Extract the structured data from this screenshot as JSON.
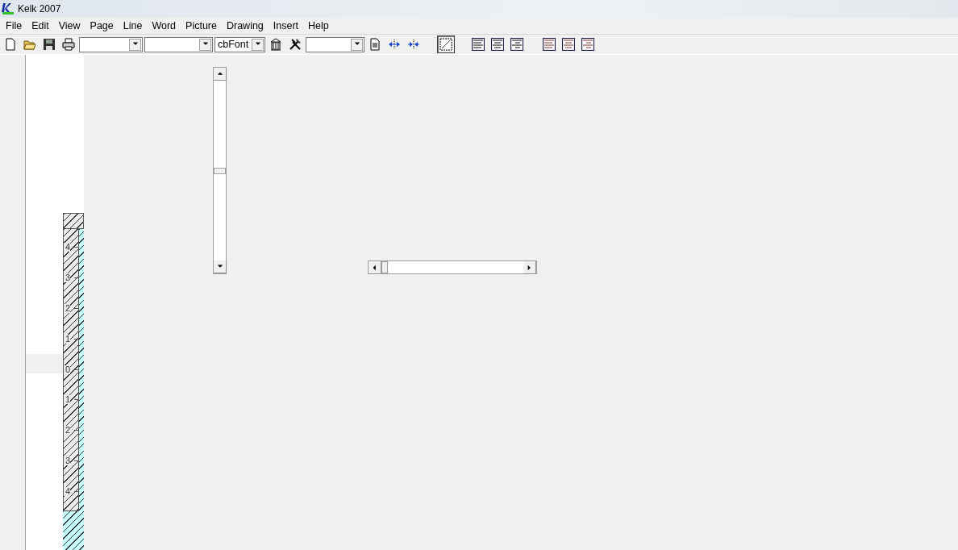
{
  "window": {
    "title": "Kelk 2007"
  },
  "menu": [
    "File",
    "Edit",
    "View",
    "Page",
    "Line",
    "Word",
    "Picture",
    "Drawing",
    "Insert",
    "Help"
  ],
  "toolbar": [
    {
      "kind": "button"
    },
    {
      "kind": "button"
    },
    {
      "kind": "button"
    },
    {
      "kind": "button"
    },
    {
      "kind": "combo"
    },
    {
      "kind": "combo"
    },
    {
      "kind": "combo",
      "value": "cbFont"
    },
    {
      "kind": "button"
    },
    {
      "kind": "button"
    },
    {
      "kind": "combo"
    },
    {
      "kind": "button"
    },
    {
      "kind": "button"
    },
    {
      "kind": "button"
    },
    {
      "kind": "gap"
    },
    {
      "kind": "button",
      "pressed": true
    },
    {
      "kind": "gap"
    },
    {
      "kind": "button"
    },
    {
      "kind": "button"
    },
    {
      "kind": "button"
    },
    {
      "kind": "gap"
    },
    {
      "kind": "button"
    },
    {
      "kind": "button"
    },
    {
      "kind": "button"
    }
  ],
  "ruler": {
    "labels": [
      "4",
      "3",
      "2",
      "1",
      "0",
      "1",
      "2",
      "3",
      "4"
    ]
  }
}
